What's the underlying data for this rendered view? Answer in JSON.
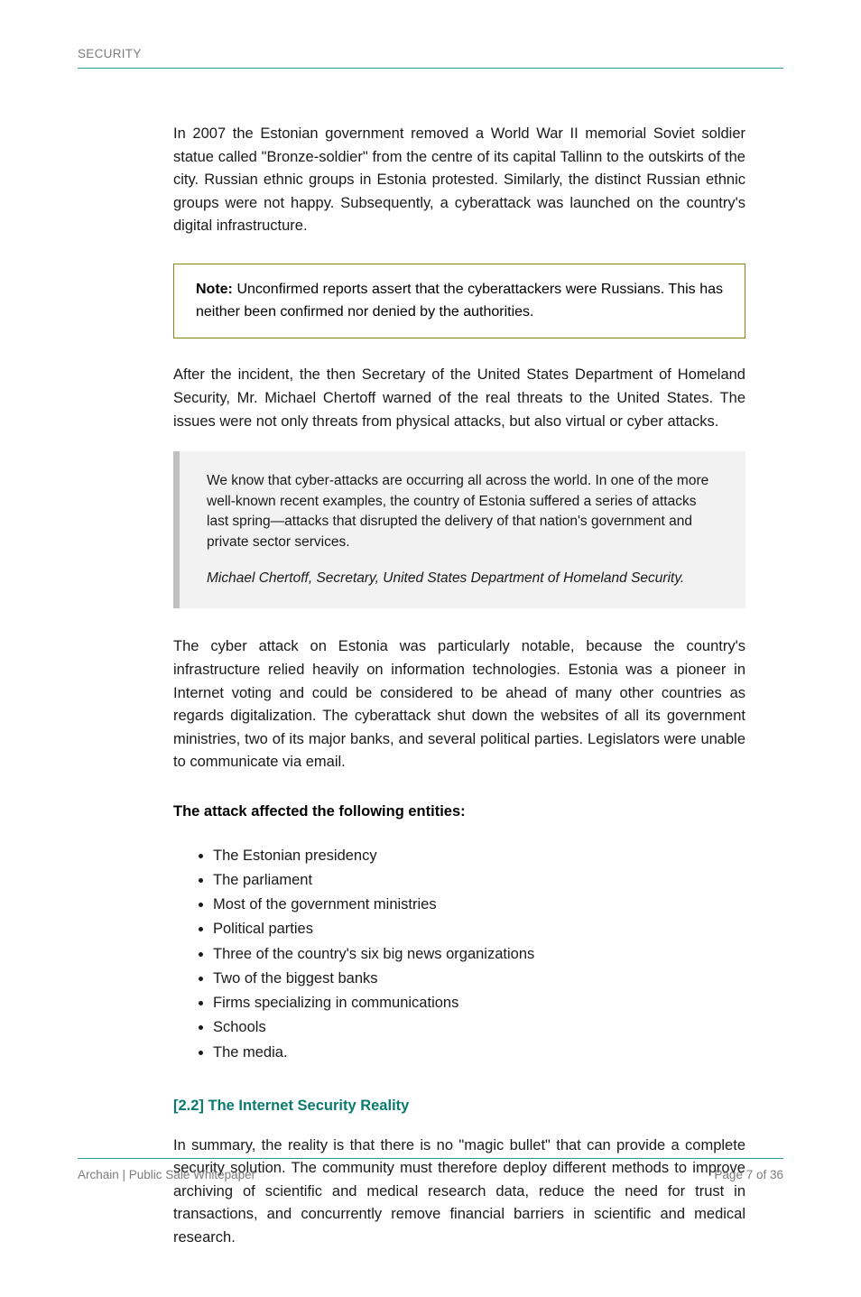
{
  "header": {
    "label": "SECURITY"
  },
  "content": {
    "intro": "In 2007 the Estonian government removed a World War II memorial Soviet soldier statue called \"Bronze-soldier\" from the centre of its capital Tallinn to the outskirts of the city. Russian ethnic groups in Estonia protested. Similarly, the distinct Russian ethnic groups were not happy. Subsequently, a cyberattack was launched on the country's digital infrastructure.",
    "note_label": "Note:",
    "note_body": "Unconfirmed reports assert that the cyberattackers were Russians. This has neither been confirmed nor denied by the authorities.",
    "aftermath": "After the incident, the then Secretary of the United States Department of Homeland Security, Mr. Michael Chertoff warned of the real threats to the United States. The issues were not only threats from physical attacks, but also virtual or cyber attacks.",
    "quote_body": "We know that cyber-attacks are occurring all across the world. In one of the more well-known recent examples, the country of Estonia suffered a series of attacks last spring—attacks that disrupted the delivery of that nation's government and private sector services.",
    "quote_cite": "Michael Chertoff, Secretary, United States Department of Homeland Security.",
    "attack_summary": "The cyber attack on Estonia was particularly notable, because the country's infrastructure relied heavily on information technologies. Estonia was a pioneer in Internet voting and could be considered to be ahead of many other countries as regards digitalization. The cyberattack shut down the websites of all its government ministries, two of its major banks, and several political parties. Legislators were unable to communicate via email.",
    "targets_heading": "The attack affected the following entities:",
    "targets": [
      "The Estonian presidency",
      "The parliament",
      "Most of the government ministries",
      "Political parties",
      "Three of the country's six big news organizations",
      "Two of the biggest banks",
      "Firms specializing in communications",
      "Schools",
      "The media."
    ],
    "security_heading": "[2.2] The Internet Security Reality",
    "security_body": "In summary, the reality is that there is no \"magic bullet\" that can provide a complete security solution. The community must therefore deploy different methods to improve archiving of scientific and medical research data, reduce the need for trust in transactions, and concurrently remove financial barriers in scientific and medical research."
  },
  "footer": {
    "left": "Archain | Public Sale Whitepaper",
    "right": "Page 7 of 36"
  }
}
